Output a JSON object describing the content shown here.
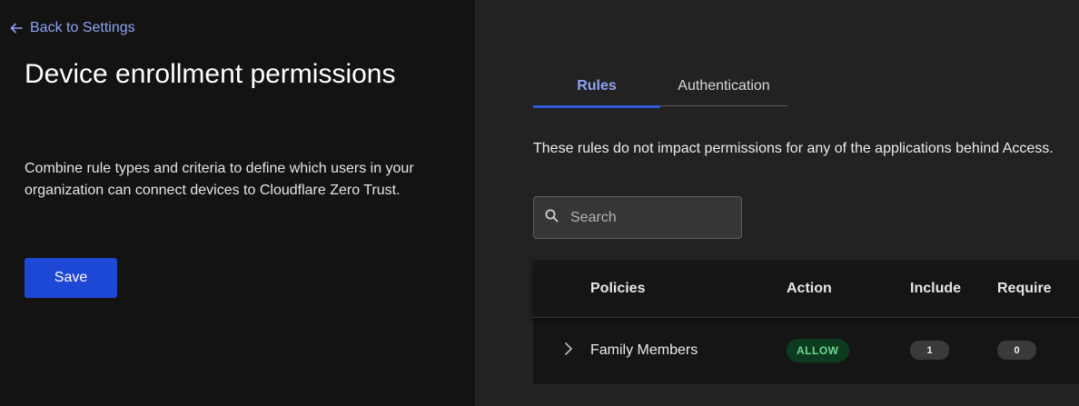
{
  "sidebar": {
    "back_label": "Back to Settings",
    "title": "Device enrollment permissions",
    "description": "Combine rule types and criteria to define which users in your organization can connect devices to Cloudflare Zero Trust.",
    "save_label": "Save"
  },
  "tabs": [
    {
      "label": "Rules",
      "active": true
    },
    {
      "label": "Authentication",
      "active": false
    }
  ],
  "info_text": "These rules do not impact permissions for any of the applications behind Access.",
  "search": {
    "placeholder": "Search",
    "value": ""
  },
  "table": {
    "columns": [
      "Policies",
      "Action",
      "Include",
      "Require"
    ],
    "rows": [
      {
        "policy": "Family Members",
        "action": "ALLOW",
        "include": "1",
        "require": "0"
      }
    ]
  },
  "colors": {
    "accent": "#8fa2f2",
    "primary_button": "#1d47d5",
    "allow_badge_bg": "#0d3b1f",
    "allow_badge_text": "#6fd492"
  },
  "icons": {
    "back": "arrow-left-icon",
    "search": "search-icon",
    "expand": "chevron-right-icon"
  }
}
